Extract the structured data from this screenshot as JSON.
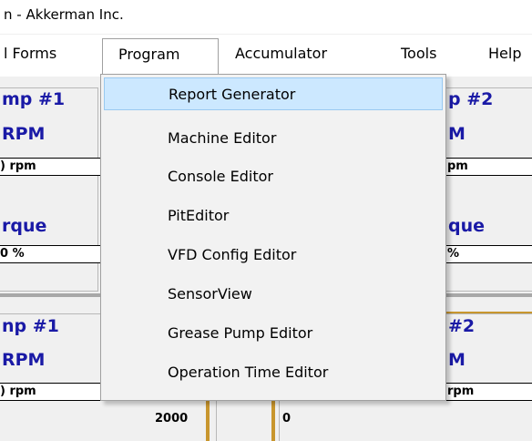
{
  "window": {
    "title": "n - Akkerman Inc."
  },
  "menubar": {
    "items": [
      "l Forms",
      "Program",
      "Accumulator",
      "Tools",
      "Help"
    ]
  },
  "program_menu": {
    "items": [
      "Report Generator",
      "Machine Editor",
      "Console Editor",
      "PitEditor",
      "VFD Config Editor",
      "SensorView",
      "Grease Pump Editor",
      "Operation Time Editor"
    ],
    "highlighted_index": 0
  },
  "background": {
    "left_top": {
      "pump": "mp #1",
      "rpm_label": "RPM",
      "rpm_value": ") rpm",
      "torque_label": "rque",
      "torque_value": "0 %"
    },
    "right_top": {
      "pump": "p #2",
      "rpm_label": "M",
      "rpm_value": "pm",
      "torque_label": "que",
      "torque_value": "%"
    },
    "left_bottom": {
      "pump": "np #1",
      "rpm_label": "RPM",
      "rpm_value": ") rpm",
      "value": "2000"
    },
    "right_bottom": {
      "pump": "#2",
      "rpm_label": "M",
      "rpm_value": "rpm",
      "value": "0"
    }
  },
  "colors": {
    "label_blue": "#1a1aa6",
    "highlight": "#cce8ff",
    "gold": "#c8962e"
  }
}
